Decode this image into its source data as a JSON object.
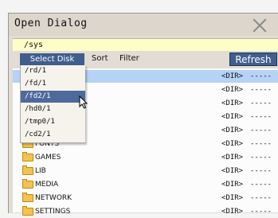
{
  "window": {
    "title": "Open Dialog"
  },
  "path": {
    "value": "/sys"
  },
  "toolbar": {
    "select_disk_label": "Select Disk",
    "sort_label": "Sort",
    "filter_label": "Filter",
    "refresh_label": "Refresh"
  },
  "dropdown": {
    "items": [
      {
        "label": "/rd/1"
      },
      {
        "label": "/fd/1"
      },
      {
        "label": "/fd2/1",
        "active": true
      },
      {
        "label": "/hd0/1"
      },
      {
        "label": "/tmp0/1"
      },
      {
        "label": "/cd2/1"
      }
    ]
  },
  "files": {
    "rows": [
      {
        "name": "",
        "type": "<DIR>",
        "size": "-----",
        "selected": true,
        "icon": "folder-icon"
      },
      {
        "name": "",
        "type": "<DIR>",
        "size": "-----",
        "icon": "folder-icon"
      },
      {
        "name": "",
        "type": "<DIR>",
        "size": "-----",
        "icon": "folder-icon"
      },
      {
        "name": "",
        "type": "<DIR>",
        "size": "-----",
        "icon": "folder-icon"
      },
      {
        "name": "ers",
        "type": "<DIR>",
        "size": "-----",
        "icon": "folder-icon"
      },
      {
        "name": "FONTS",
        "type": "<DIR>",
        "size": "-----",
        "icon": "folder-icon"
      },
      {
        "name": "GAMES",
        "type": "<DIR>",
        "size": "-----",
        "icon": "folder-icon"
      },
      {
        "name": "LIB",
        "type": "<DIR>",
        "size": "-----",
        "icon": "folder-icon"
      },
      {
        "name": "MEDIA",
        "type": "<DIR>",
        "size": "-----",
        "icon": "folder-icon"
      },
      {
        "name": "NETWORK",
        "type": "<DIR>",
        "size": "-----",
        "icon": "folder-icon"
      },
      {
        "name": "SETTINGS",
        "type": "<DIR>",
        "size": "-----",
        "icon": "folder-icon"
      }
    ]
  },
  "colors": {
    "accent": "#3f5d8d",
    "selection": "#b5d2f7",
    "path_background": "#fdfdc8",
    "folder": "#f2c34e"
  }
}
